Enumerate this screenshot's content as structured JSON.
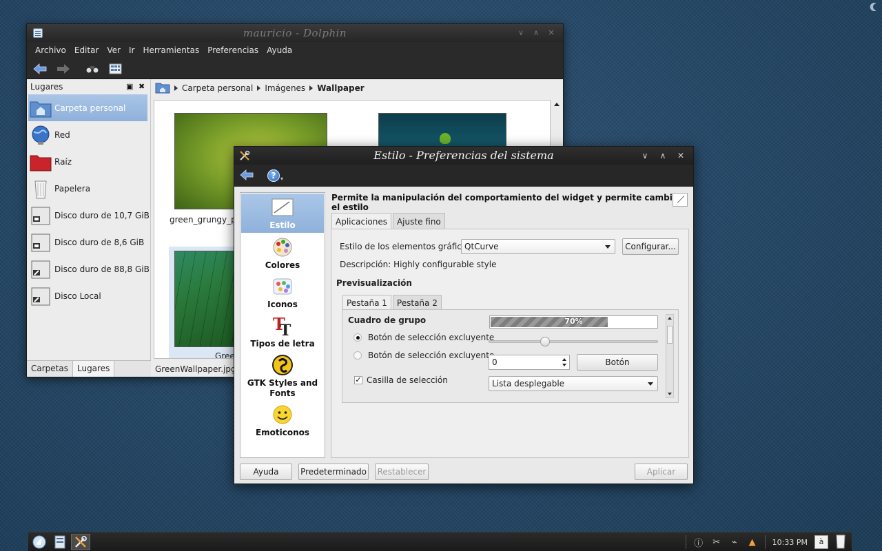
{
  "dolphin": {
    "title": "mauricio - Dolphin",
    "menu": [
      "Archivo",
      "Editar",
      "Ver",
      "Ir",
      "Herramientas",
      "Preferencias",
      "Ayuda"
    ],
    "places_header": "Lugares",
    "places": [
      {
        "label": "Carpeta personal",
        "icon": "home-folder-icon",
        "selected": true
      },
      {
        "label": "Red",
        "icon": "network-globe-icon"
      },
      {
        "label": "Raíz",
        "icon": "root-folder-icon"
      },
      {
        "label": "Papelera",
        "icon": "trash-icon"
      },
      {
        "label": "Disco duro de 10,7 GiB",
        "icon": "hard-drive-icon"
      },
      {
        "label": "Disco duro de 8,6 GiB",
        "icon": "hard-drive-icon"
      },
      {
        "label": "Disco duro de 88,8 GiB",
        "icon": "hard-drive-icon"
      },
      {
        "label": "Disco Local",
        "icon": "hard-drive-icon"
      }
    ],
    "bottom_tabs": [
      "Carpetas",
      "Lugares"
    ],
    "breadcrumb": [
      "Carpeta personal",
      "Imágenes",
      "Wallpaper"
    ],
    "files": [
      {
        "label": "green_grungy_pap"
      },
      {
        "label": "Green"
      }
    ],
    "status": "GreenWallpaper.jpg (i"
  },
  "dialog": {
    "title": "Estilo - Preferencias del sistema",
    "categories": [
      {
        "label": "Estilo",
        "icon": "style-brush-icon",
        "selected": true
      },
      {
        "label": "Colores",
        "icon": "colors-palette-icon"
      },
      {
        "label": "Iconos",
        "icon": "icons-set-icon"
      },
      {
        "label": "Tipos de letra",
        "icon": "fonts-icon"
      },
      {
        "label": "GTK Styles and Fonts",
        "icon": "gtk-icon"
      },
      {
        "label": "Emoticonos",
        "icon": "smiley-icon"
      }
    ],
    "description_title": "Permite la manipulación del comportamiento del widget y permite cambiar el estilo",
    "tabs": [
      "Aplicaciones",
      "Ajuste fino"
    ],
    "widget_style_label": "Estilo de los elementos gráficos:",
    "widget_style_value": "QtCurve",
    "configure_button": "Configurar...",
    "description": "Descripción: Highly configurable style",
    "preview_label": "Previsualización",
    "preview_tabs": [
      "Pestaña 1",
      "Pestaña 2"
    ],
    "preview": {
      "group_box": "Cuadro de grupo",
      "progress_text": "70%",
      "progress_value": 0.7,
      "radio_1": "Botón de selección excluyente",
      "radio_2": "Botón de selección excluyente",
      "spin_value": "0",
      "button": "Botón",
      "checkbox": "Casilla de selección",
      "combo": "Lista desplegable",
      "slider_value": 0.33
    },
    "buttons": {
      "help": "Ayuda",
      "defaults": "Predeterminado",
      "reset": "Restablecer",
      "apply": "Aplicar"
    }
  },
  "taskbar": {
    "clock": "10:33 PM",
    "tray_language": "à"
  }
}
